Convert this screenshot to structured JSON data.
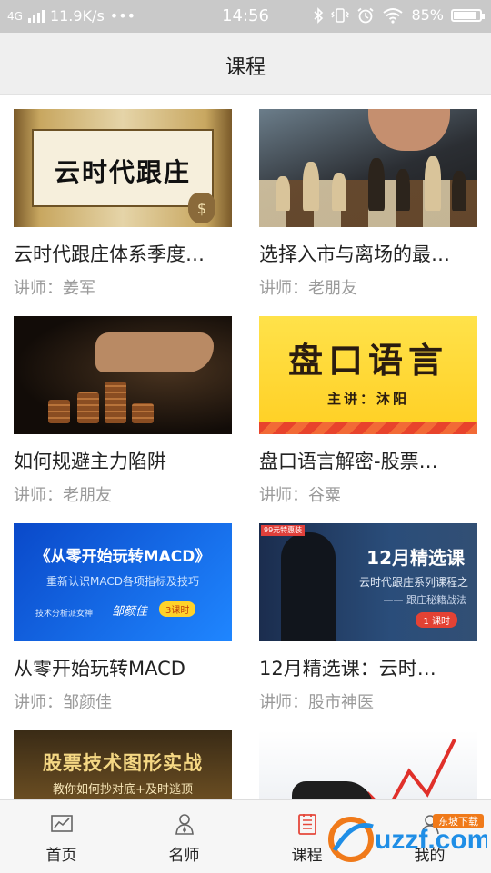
{
  "status_bar": {
    "network": "4G",
    "speed": "11.9K/s",
    "dots": "•••",
    "time": "14:56",
    "battery": "85%",
    "battery_level": 0.85,
    "icons": [
      "signal-icon",
      "bluetooth-icon",
      "vibrate-icon",
      "alarm-icon",
      "wifi-icon",
      "battery-icon"
    ]
  },
  "header": {
    "title": "课程"
  },
  "courses": [
    {
      "title": "云时代跟庄体系季度…",
      "teacher": "讲师：姜军",
      "thumb_text": [
        "云时代跟庄",
        "$"
      ]
    },
    {
      "title": "选择入市与离场的最…",
      "teacher": "讲师：老朋友",
      "thumb_text": []
    },
    {
      "title": "如何规避主力陷阱",
      "teacher": "讲师：老朋友",
      "thumb_text": []
    },
    {
      "title": "盘口语言解密-股票…",
      "teacher": "讲师：谷粟",
      "thumb_text": [
        "盘口语言",
        "主讲：沐阳"
      ]
    },
    {
      "title": "从零开始玩转MACD",
      "teacher": "讲师：邹颜佳",
      "thumb_text": [
        "《从零开始玩转MACD》",
        "重新认识MACD各项指标及技巧",
        "技术分析派女神",
        "邹颜佳",
        "3课时"
      ]
    },
    {
      "title": "12月精选课：云时…",
      "teacher": "讲师：股市神医",
      "thumb_text": [
        "99元特惠装",
        "12月精选课",
        "云时代跟庄系列课程之",
        "—— 跟庄秘籍战法",
        "1 课时"
      ]
    },
    {
      "title": "",
      "teacher": "",
      "thumb_text": [
        "股票技术图形实战",
        "教你如何抄对底+及时逃顶"
      ]
    },
    {
      "title": "",
      "teacher": "",
      "thumb_text": []
    }
  ],
  "tabs": [
    {
      "label": "首页",
      "icon": "chart-icon",
      "active": false
    },
    {
      "label": "名师",
      "icon": "teacher-icon",
      "active": false
    },
    {
      "label": "课程",
      "icon": "course-list-icon",
      "active": true
    },
    {
      "label": "我的",
      "icon": "profile-icon",
      "active": false
    }
  ],
  "watermark": {
    "text": "uzzf.com",
    "sub": "东坡下载"
  },
  "colors": {
    "accent": "#e5483b",
    "title_bar": "#efefef",
    "status_bar": "#c9c9c9",
    "teacher_text": "#9a9a9a"
  }
}
